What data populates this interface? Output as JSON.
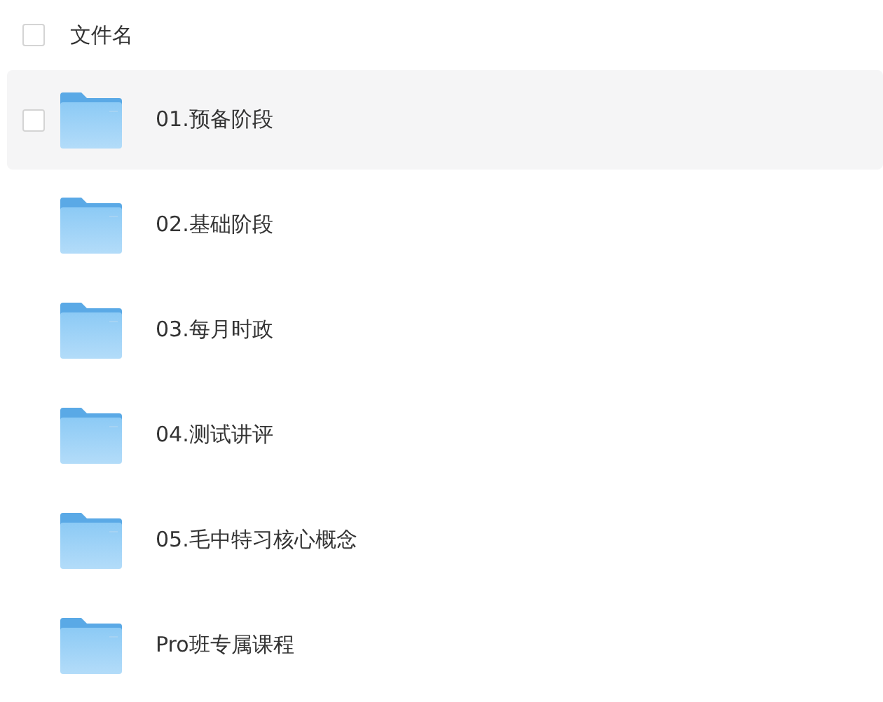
{
  "header": {
    "checked": false,
    "label": "文件名"
  },
  "files": [
    {
      "name": "01.预备阶段",
      "hovered": true,
      "checked": false
    },
    {
      "name": "02.基础阶段",
      "hovered": false,
      "checked": false
    },
    {
      "name": "03.每月时政",
      "hovered": false,
      "checked": false
    },
    {
      "name": "04.测试讲评",
      "hovered": false,
      "checked": false
    },
    {
      "name": "05.毛中特习核心概念",
      "hovered": false,
      "checked": false
    },
    {
      "name": "Pro班专属课程",
      "hovered": false,
      "checked": false
    }
  ]
}
